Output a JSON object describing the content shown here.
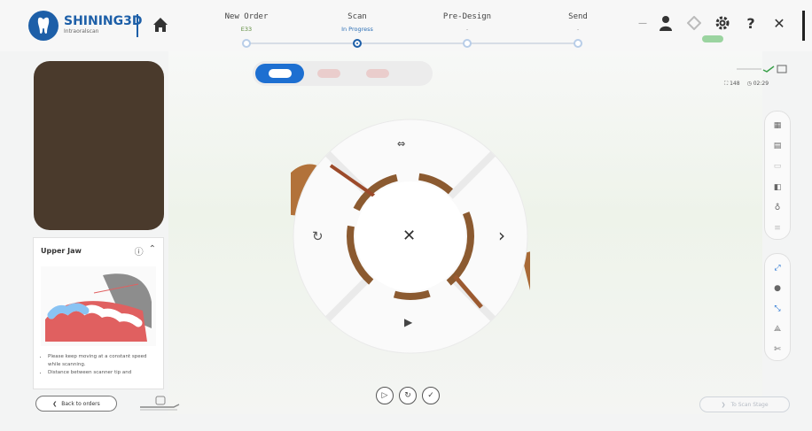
{
  "app": {
    "brand": "SHINING3D",
    "brand_sub": "Intraoralscan"
  },
  "steps": [
    {
      "title": "New Order",
      "status": "E33",
      "state": "done"
    },
    {
      "title": "Scan",
      "status": "In Progress",
      "state": "active"
    },
    {
      "title": "Pre-Design",
      "status": "-",
      "state": "pending"
    },
    {
      "title": "Send",
      "status": "-",
      "state": "pending"
    }
  ],
  "header_icons": [
    "user-icon",
    "diamond-icon",
    "gear-icon",
    "help-icon",
    "close-icon"
  ],
  "help_label": "?",
  "close_label": "✕",
  "counters": {
    "count": "148",
    "time": "02:29"
  },
  "info_card": {
    "title": "Upper Jaw",
    "tips": [
      "Please keep moving at a constant speed while scanning.",
      "Distance between scanner tip and"
    ]
  },
  "back_button": "Back to orders",
  "next_button": "To Scan Stage",
  "radial_menu": {
    "top": "⇔",
    "left": "↻",
    "center": "✕",
    "right": "›",
    "bottom": "▶"
  },
  "bottom_controls": [
    "▷",
    "↻",
    "✓"
  ],
  "colors": {
    "brand_blue": "#1d5fa8",
    "active_blue": "#1d6fd1",
    "status_green": "#5b8a3a"
  }
}
